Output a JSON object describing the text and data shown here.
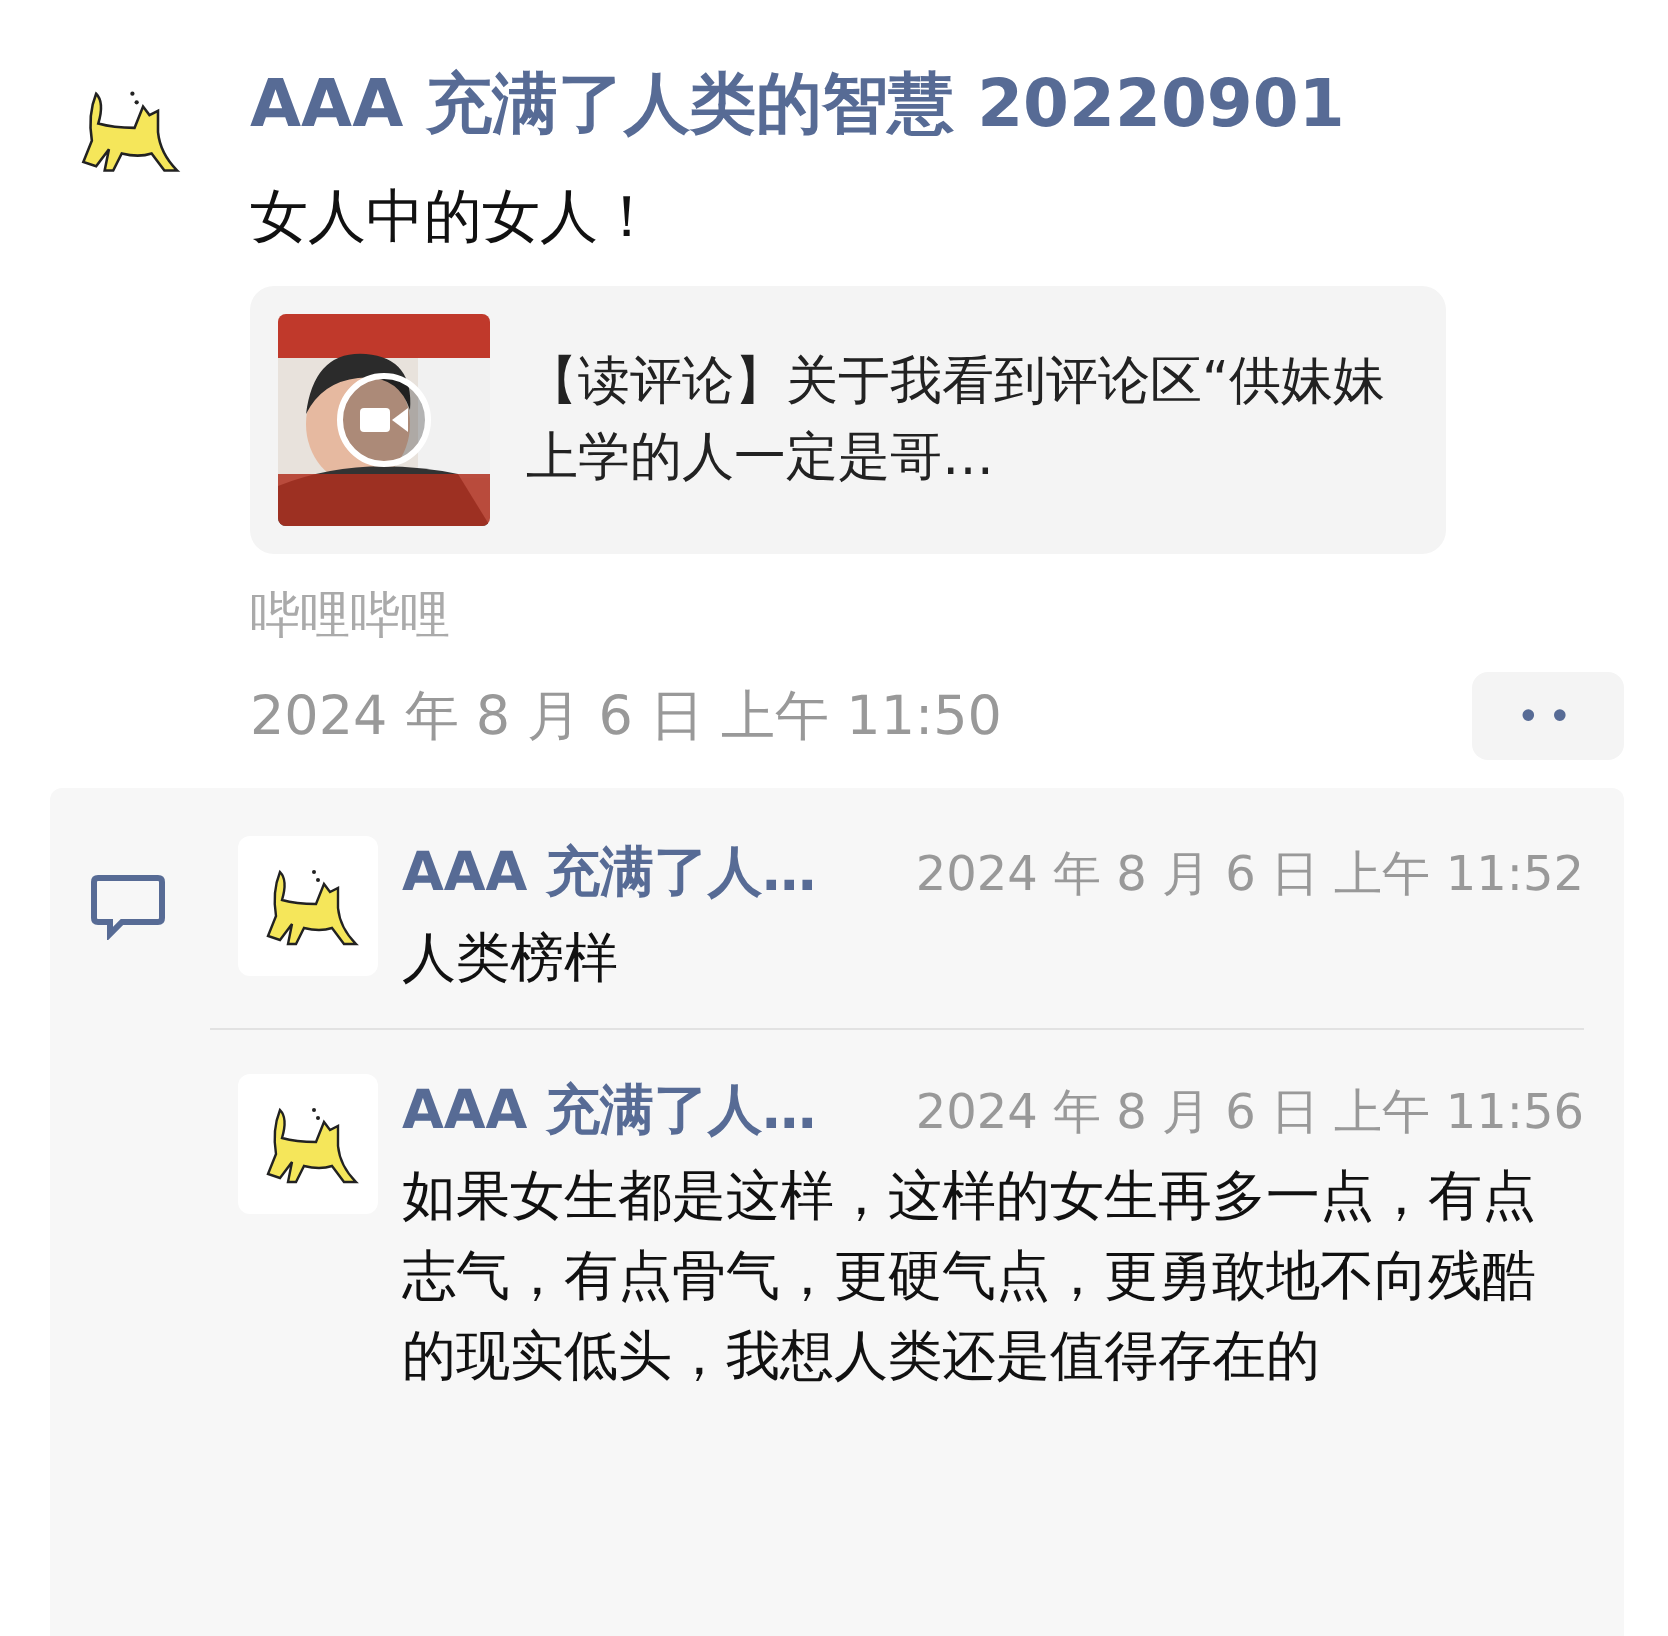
{
  "post": {
    "author": "AAA 充满了人类的智慧 20220901",
    "text": "女人中的女人！",
    "link_card": {
      "title": "【读评论】关于我看到评论区“供妹妹上学的人一定是哥…"
    },
    "source": "哔哩哔哩",
    "time": "2024 年 8 月 6 日 上午 11:50",
    "more_button": "••"
  },
  "comments": [
    {
      "author": "AAA 充满了人…",
      "time": "2024 年 8 月 6 日 上午 11:52",
      "text": "人类榜样"
    },
    {
      "author": "AAA 充满了人…",
      "time": "2024 年 8 月 6 日 上午 11:56",
      "text": "如果女生都是这样，这样的女生再多一点，有点志气，有点骨气，更硬气点，更勇敢地不向残酷的现实低头，我想人类还是值得存在的"
    }
  ]
}
